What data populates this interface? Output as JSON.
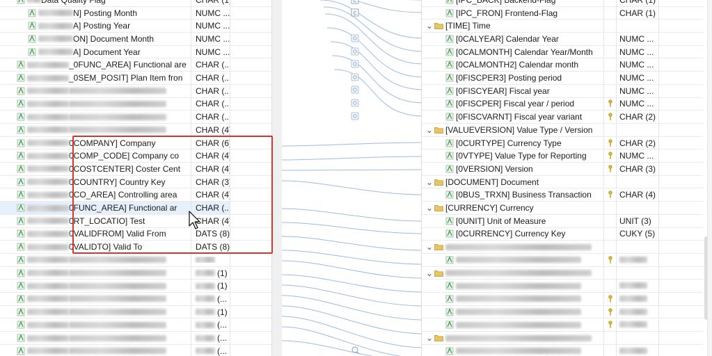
{
  "left_table": {
    "rows": [
      {
        "text": "Data Quality Flag",
        "type": "CHAR (1)",
        "prefix_blur": 36,
        "selected": false
      },
      {
        "text": "N] Posting Month",
        "type": "NUMC ...",
        "prefix_blur": 66,
        "selected": false
      },
      {
        "text": "A] Posting Year",
        "type": "NUMC ...",
        "prefix_blur": 66,
        "selected": false
      },
      {
        "text": "ON] Document Month",
        "type": "NUMC ...",
        "prefix_blur": 66,
        "selected": false
      },
      {
        "text": "A] Document Year",
        "type": "NUMC ...",
        "prefix_blur": 66,
        "selected": false
      },
      {
        "text": "_0FUNC_AREA] Functional are",
        "type": "CHAR (...",
        "prefix_blur": 76,
        "selected": false
      },
      {
        "text": "_0SEM_POSIT] Plan Item fron",
        "type": "CHAR (...",
        "prefix_blur": 76,
        "selected": false
      },
      {
        "text": "",
        "type": "CHAR (...",
        "prefix_blur": 76,
        "selected": false
      },
      {
        "text": "",
        "type": "CHAR (...",
        "prefix_blur": 76,
        "selected": false
      },
      {
        "text": "",
        "type": "CHAR (...",
        "prefix_blur": 76,
        "selected": false
      },
      {
        "text": "",
        "type": "CHAR (4)",
        "prefix_blur": 76,
        "selected": false
      },
      {
        "text": "0COMPANY] Company",
        "type": "CHAR (6)",
        "prefix_blur": 76,
        "selected": false
      },
      {
        "text": "0COMP_CODE] Company co",
        "type": "CHAR (4)",
        "prefix_blur": 76,
        "selected": false
      },
      {
        "text": "0COSTCENTER] Coster Cent",
        "type": "CHAR (4)",
        "prefix_blur": 76,
        "selected": false
      },
      {
        "text": "0COUNTRY] Country Key",
        "type": "CHAR (3)",
        "prefix_blur": 76,
        "selected": false
      },
      {
        "text": "0CO_AREA] Controlling area",
        "type": "CHAR (4)",
        "prefix_blur": 76,
        "selected": false
      },
      {
        "text": "0FUNC_AREA] Functional ar",
        "type": "CHAR (...",
        "prefix_blur": 76,
        "selected": true
      },
      {
        "text": "0RT_LOCATIO] Test",
        "type": "CHAR (4)",
        "prefix_blur": 76,
        "selected": false
      },
      {
        "text": "0VALIDFROM] Valid From",
        "type": "DATS (8)",
        "prefix_blur": 76,
        "selected": false
      },
      {
        "text": "0VALIDTO] Valid To",
        "type": "DATS (8)",
        "prefix_blur": 76,
        "selected": false
      },
      {
        "text": "",
        "type": "",
        "prefix_blur": 76,
        "selected": false
      },
      {
        "text": "",
        "type": "(1)",
        "prefix_blur": 76,
        "selected": false
      },
      {
        "text": "",
        "type": "(1)",
        "prefix_blur": 76,
        "selected": false
      },
      {
        "text": "",
        "type": "(...",
        "prefix_blur": 76,
        "selected": false
      },
      {
        "text": "",
        "type": "(1)",
        "prefix_blur": 76,
        "selected": false
      },
      {
        "text": "",
        "type": "(...",
        "prefix_blur": 76,
        "selected": false
      },
      {
        "text": "",
        "type": "(...",
        "prefix_blur": 76,
        "selected": false
      },
      {
        "text": "",
        "type": "(...",
        "prefix_blur": 76,
        "selected": false
      }
    ]
  },
  "right_table": {
    "rows": [
      {
        "level": 2,
        "kind": "field",
        "text": "[IPC_BACK] Backend-Flag",
        "type": "CHAR (1)",
        "key": false
      },
      {
        "level": 2,
        "kind": "field",
        "text": "[IPC_FRON] Frontend-Flag",
        "type": "CHAR (1)",
        "key": false
      },
      {
        "level": 1,
        "kind": "folder",
        "text": "[TIME] Time",
        "type": "",
        "key": false
      },
      {
        "level": 2,
        "kind": "field",
        "text": "[0CALYEAR] Calendar Year",
        "type": "NUMC ...",
        "key": false
      },
      {
        "level": 2,
        "kind": "field",
        "text": "[0CALMONTH] Calendar Year/Month",
        "type": "NUMC ...",
        "key": false
      },
      {
        "level": 2,
        "kind": "field",
        "text": "[0CALMONTH2] Calendar month",
        "type": "NUMC ...",
        "key": false
      },
      {
        "level": 2,
        "kind": "field",
        "text": "[0FISCPER3] Posting period",
        "type": "NUMC ...",
        "key": false
      },
      {
        "level": 2,
        "kind": "field",
        "text": "[0FISCYEAR] Fiscal year",
        "type": "NUMC ...",
        "key": false
      },
      {
        "level": 2,
        "kind": "field",
        "text": "[0FISCPER] Fiscal year / period",
        "type": "NUMC ...",
        "key": true
      },
      {
        "level": 2,
        "kind": "field",
        "text": "[0FISCVARNT] Fiscal year variant",
        "type": "CHAR (2)",
        "key": true
      },
      {
        "level": 1,
        "kind": "folder",
        "text": "[VALUEVERSION] Value Type / Version",
        "type": "",
        "key": false
      },
      {
        "level": 2,
        "kind": "field",
        "text": "[0CURTYPE] Currency Type",
        "type": "CHAR (2)",
        "key": true
      },
      {
        "level": 2,
        "kind": "field",
        "text": "[0VTYPE] Value Type for Reporting",
        "type": "NUMC ...",
        "key": true
      },
      {
        "level": 2,
        "kind": "field",
        "text": "[0VERSION] Version",
        "type": "CHAR (3)",
        "key": true
      },
      {
        "level": 1,
        "kind": "folder",
        "text": "[DOCUMENT] Document",
        "type": "",
        "key": false
      },
      {
        "level": 2,
        "kind": "field",
        "text": "[0BUS_TRXN] Business Transaction",
        "type": "CHAR (4)",
        "key": true
      },
      {
        "level": 1,
        "kind": "folder",
        "text": "[CURRENCY] Currency",
        "type": "",
        "key": false
      },
      {
        "level": 2,
        "kind": "field",
        "text": "[0UNIT] Unit of Measure",
        "type": "UNIT (3)",
        "key": false
      },
      {
        "level": 2,
        "kind": "field",
        "text": "[0CURRENCY] Currency Key",
        "type": "CUKY (5)",
        "key": false
      },
      {
        "level": 1,
        "kind": "folder-blur",
        "text": "",
        "type": "",
        "key": false
      },
      {
        "level": 2,
        "kind": "field-blur",
        "text": "",
        "type": "",
        "key": true
      },
      {
        "level": 1,
        "kind": "folder-blur",
        "text": "",
        "type": "",
        "key": false
      },
      {
        "level": 2,
        "kind": "field-blur",
        "text": "",
        "type": "",
        "key": false
      },
      {
        "level": 2,
        "kind": "field-blur",
        "text": "",
        "type": "",
        "key": true
      },
      {
        "level": 2,
        "kind": "field-blur",
        "text": "",
        "type": "",
        "key": true
      },
      {
        "level": 2,
        "kind": "field-blur",
        "text": "",
        "type": "",
        "key": true
      },
      {
        "level": 1,
        "kind": "folder-blur",
        "text": "",
        "type": "",
        "key": false
      },
      {
        "level": 2,
        "kind": "field-blur",
        "text": "",
        "type": "",
        "key": false
      }
    ]
  },
  "colors": {
    "selection": "#e5f0fb",
    "highlight_box": "#d9342b",
    "mapping_line": "#9bbce0",
    "folder": "#e8c462",
    "field_icon": "#4a9c58"
  },
  "icons": {
    "field": "field-icon",
    "folder": "folder-icon",
    "key": "key-icon",
    "cursor": "mouse-pointer-icon"
  }
}
